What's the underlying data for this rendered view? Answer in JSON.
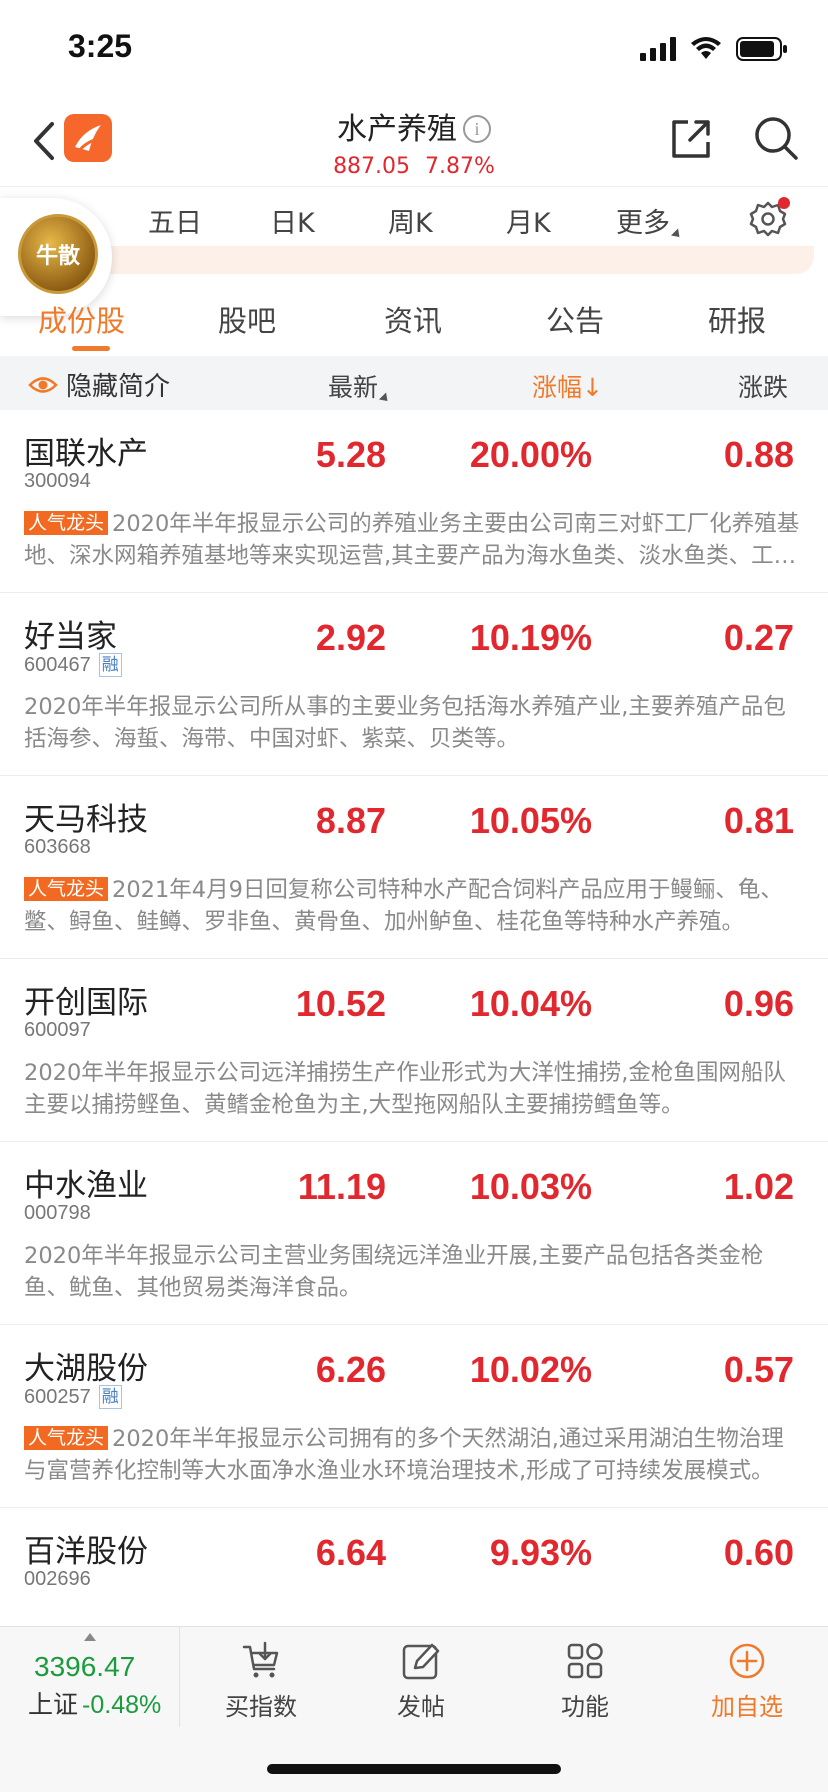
{
  "status_bar": {
    "time": "3:25"
  },
  "header": {
    "title": "水产养殖",
    "info_glyph": "i",
    "price": "887.05",
    "change_pct": "7.87%",
    "accent_color": "#e0282e"
  },
  "chart_tabs": [
    {
      "label": "五日"
    },
    {
      "label": "日K"
    },
    {
      "label": "周K"
    },
    {
      "label": "月K"
    },
    {
      "label": "更多"
    }
  ],
  "float_badge": {
    "text": "牛散"
  },
  "section_tabs": [
    {
      "label": "成份股",
      "active": true
    },
    {
      "label": "股吧"
    },
    {
      "label": "资讯"
    },
    {
      "label": "公告"
    },
    {
      "label": "研报"
    }
  ],
  "columns": {
    "hide_intro": "隐藏简介",
    "latest": "最新",
    "change_pct": "涨幅",
    "sort_arrow": "↓",
    "change_amt": "涨跌"
  },
  "stocks": [
    {
      "name": "国联水产",
      "code": "300094",
      "rong": "",
      "latest": "5.28",
      "pct": "20.00%",
      "amt": "0.88",
      "tag": "人气龙头",
      "desc": "2020年半年报显示公司的养殖业务主要由公司南三对虾工厂化养殖基地、深水网箱养殖基地等来实现运营,其主要产品为海水鱼类、淡水鱼类、工业化养殖对虾类。"
    },
    {
      "name": "好当家",
      "code": "600467",
      "rong": "融",
      "latest": "2.92",
      "pct": "10.19%",
      "amt": "0.27",
      "tag": "",
      "desc": "2020年半年报显示公司所从事的主要业务包括海水养殖产业,主要养殖产品包括海参、海蜇、海带、中国对虾、紫菜、贝类等。"
    },
    {
      "name": "天马科技",
      "code": "603668",
      "rong": "",
      "latest": "8.87",
      "pct": "10.05%",
      "amt": "0.81",
      "tag": "人气龙头",
      "desc": "2021年4月9日回复称公司特种水产配合饲料产品应用于鳗鲡、龟、鳖、鲟鱼、鲑鳟、罗非鱼、黄骨鱼、加州鲈鱼、桂花鱼等特种水产养殖。"
    },
    {
      "name": "开创国际",
      "code": "600097",
      "rong": "",
      "latest": "10.52",
      "pct": "10.04%",
      "amt": "0.96",
      "tag": "",
      "desc": "2020年半年报显示公司远洋捕捞生产作业形式为大洋性捕捞,金枪鱼围网船队主要以捕捞鲣鱼、黄鳍金枪鱼为主,大型拖网船队主要捕捞鳕鱼等。"
    },
    {
      "name": "中水渔业",
      "code": "000798",
      "rong": "",
      "latest": "11.19",
      "pct": "10.03%",
      "amt": "1.02",
      "tag": "",
      "desc": "2020年半年报显示公司主营业务围绕远洋渔业开展,主要产品包括各类金枪鱼、鱿鱼、其他贸易类海洋食品。"
    },
    {
      "name": "大湖股份",
      "code": "600257",
      "rong": "融",
      "latest": "6.26",
      "pct": "10.02%",
      "amt": "0.57",
      "tag": "人气龙头",
      "desc": "2020年半年报显示公司拥有的多个天然湖泊,通过采用湖泊生物治理与富营养化控制等大水面净水渔业水环境治理技术,形成了可持续发展模式。"
    },
    {
      "name": "百洋股份",
      "code": "002696",
      "rong": "",
      "latest": "6.64",
      "pct": "9.93%",
      "amt": "0.60",
      "tag": "",
      "desc": ""
    }
  ],
  "bottom_bar": {
    "index_value": "3396.47",
    "index_name": "上证",
    "index_change": "-0.48%",
    "buttons": [
      {
        "label": "买指数",
        "icon": "cart-icon"
      },
      {
        "label": "发帖",
        "icon": "edit-icon"
      },
      {
        "label": "功能",
        "icon": "grid-icon"
      },
      {
        "label": "加自选",
        "icon": "plus-circle-icon"
      }
    ]
  },
  "colors": {
    "up": "#e0282e",
    "down": "#1a9b3c",
    "accent": "#f07a2a",
    "tag": "#f26a21"
  }
}
